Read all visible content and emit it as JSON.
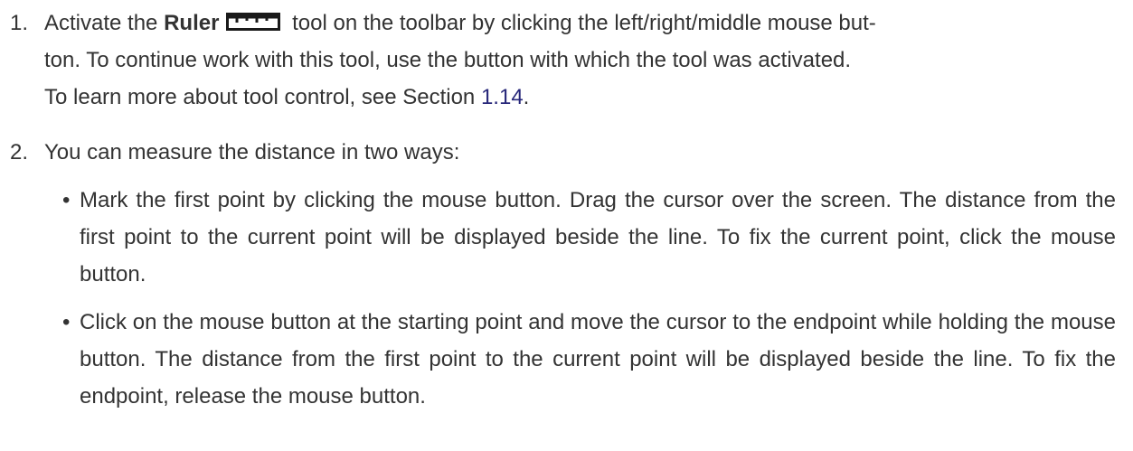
{
  "step1": {
    "number": "1.",
    "text_before": "Activate the ",
    "tool_name": "Ruler",
    "ruler_icon": "ruler-icon",
    "text_after": " tool on the toolbar by clicking the left/right/middle mouse but-",
    "line2": "ton. To continue work with this tool, use the button with which the tool was activated.",
    "line3_before": "To learn more about tool control, see Section ",
    "section_link": "1.14",
    "line3_after": "."
  },
  "step2": {
    "number": "2.",
    "intro": "You can measure the distance in two ways:",
    "bullet_mark": "•",
    "bullets": [
      {
        "text": "Mark the first point by clicking the mouse button. Drag the cursor over the screen. The distance from the first point to the current point will be displayed beside the line. To fix the current point, click the mouse button."
      },
      {
        "text": "Click on the mouse button at the starting point and move the cursor to the endpoint while holding the mouse button. The distance from the first point to the current point will be displayed beside the line. To fix the endpoint, release the mouse button."
      }
    ]
  },
  "colors": {
    "text": "#333333",
    "link": "#27277a"
  }
}
